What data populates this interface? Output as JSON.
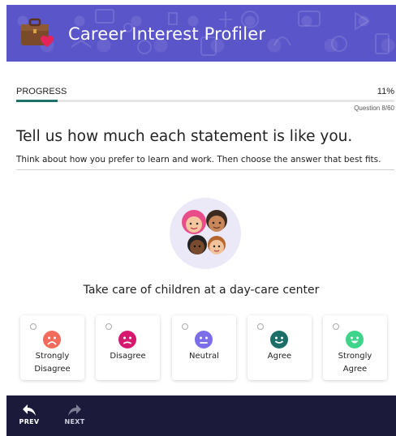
{
  "app": {
    "title": "Career Interest Profiler"
  },
  "progress": {
    "label": "PROGRESS",
    "percent_text": "11%",
    "fraction": 0.11,
    "question_count": "Question 8/60"
  },
  "prompt": {
    "heading": "Tell us how much each statement is like you.",
    "subheading": "Think about how you prefer to learn and work. Then choose the answer that best fits."
  },
  "statement": "Take care of children at a day-care center",
  "answers": [
    {
      "label_line1": "Strongly",
      "label_line2": "Disagree",
      "icon": "very-sad-face-icon",
      "color": "#f26b5b"
    },
    {
      "label_line1": "Disagree",
      "label_line2": "",
      "icon": "sad-face-icon",
      "color": "#d6196e"
    },
    {
      "label_line1": "Neutral",
      "label_line2": "",
      "icon": "neutral-face-icon",
      "color": "#7b6ee8"
    },
    {
      "label_line1": "Agree",
      "label_line2": "",
      "icon": "smile-face-icon",
      "color": "#1c6e68"
    },
    {
      "label_line1": "Strongly",
      "label_line2": "Agree",
      "icon": "big-smile-face-icon",
      "color": "#3ed489"
    }
  ],
  "footer": {
    "prev_label": "PREV",
    "next_label": "NEXT"
  },
  "colors": {
    "header_bg": "#5a55c9",
    "footer_bg": "#1b1a3a",
    "progress_fill": "#1f6f6b"
  }
}
